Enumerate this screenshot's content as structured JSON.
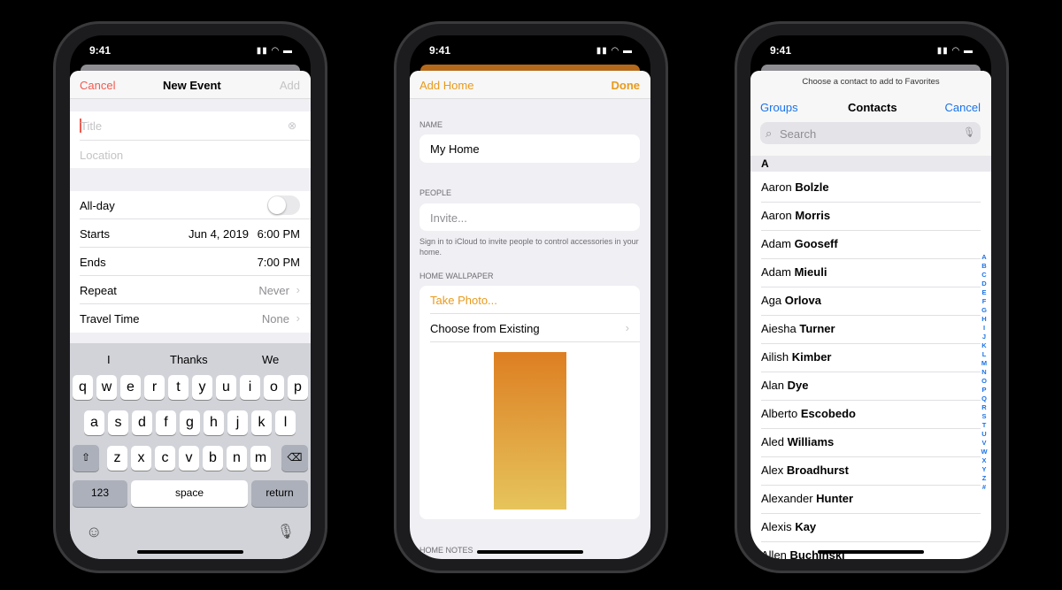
{
  "status_time": "9:41",
  "calendar": {
    "cancel": "Cancel",
    "title": "New Event",
    "add": "Add",
    "title_placeholder": "Title",
    "location_placeholder": "Location",
    "rows": [
      {
        "label": "All-day",
        "value": ""
      },
      {
        "label": "Starts",
        "date": "Jun 4, 2019",
        "value": "6:00 PM"
      },
      {
        "label": "Ends",
        "value": "7:00 PM"
      },
      {
        "label": "Repeat",
        "value": "Never"
      },
      {
        "label": "Travel Time",
        "value": "None"
      }
    ],
    "allday_on": false,
    "suggestions": [
      "I",
      "Thanks",
      "We"
    ],
    "keys_row1": [
      "q",
      "w",
      "e",
      "r",
      "t",
      "y",
      "u",
      "i",
      "o",
      "p"
    ],
    "keys_row2": [
      "a",
      "s",
      "d",
      "f",
      "g",
      "h",
      "j",
      "k",
      "l"
    ],
    "keys_row3": [
      "z",
      "x",
      "c",
      "v",
      "b",
      "n",
      "m"
    ],
    "key_123": "123",
    "key_space": "space",
    "key_return": "return",
    "accent": "#f05a4f"
  },
  "home": {
    "back": "Add Home",
    "done": "Done",
    "name_header": "NAME",
    "name_value": "My Home",
    "people_header": "PEOPLE",
    "invite_placeholder": "Invite...",
    "people_footer": "Sign in to iCloud to invite people to control accessories in your home.",
    "wallpaper_header": "HOME WALLPAPER",
    "take_photo": "Take Photo...",
    "choose_existing": "Choose from Existing",
    "notes_header": "HOME NOTES",
    "accent": "#e89a1c"
  },
  "contacts": {
    "prompt": "Choose a contact to add to Favorites",
    "groups": "Groups",
    "title": "Contacts",
    "cancel": "Cancel",
    "search_placeholder": "Search",
    "section": "A",
    "list": [
      [
        "Aaron",
        "Bolzle"
      ],
      [
        "Aaron",
        "Morris"
      ],
      [
        "Adam",
        "Gooseff"
      ],
      [
        "Adam",
        "Mieuli"
      ],
      [
        "Aga",
        "Orlova"
      ],
      [
        "Aiesha",
        "Turner"
      ],
      [
        "Ailish",
        "Kimber"
      ],
      [
        "Alan",
        "Dye"
      ],
      [
        "Alberto",
        "Escobedo"
      ],
      [
        "Aled",
        "Williams"
      ],
      [
        "Alex",
        "Broadhurst"
      ],
      [
        "Alexander",
        "Hunter"
      ],
      [
        "Alexis",
        "Kay"
      ],
      [
        "Allen",
        "Buchinski"
      ]
    ],
    "index": [
      "A",
      "B",
      "C",
      "D",
      "E",
      "F",
      "G",
      "H",
      "I",
      "J",
      "K",
      "L",
      "M",
      "N",
      "O",
      "P",
      "Q",
      "R",
      "S",
      "T",
      "U",
      "V",
      "W",
      "X",
      "Y",
      "Z",
      "#"
    ],
    "accent": "#1a73e8"
  }
}
